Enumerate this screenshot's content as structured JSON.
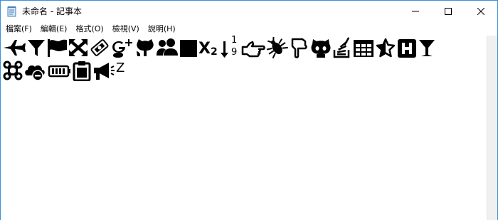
{
  "window": {
    "title": "未命名 - 記事本"
  },
  "menu": {
    "file": "檔案(F)",
    "edit": "編輯(E)",
    "format": "格式(O)",
    "view": "檢視(V)",
    "help": "說明(H)"
  },
  "editor": {
    "row1_icons": [
      "plane-icon",
      "filter-icon",
      "flag-icon",
      "arrows-expand-icon",
      "ticket-icon",
      "google-plus-icon",
      "github-alt-icon",
      "users-icon",
      "square-icon",
      "subscript-icon",
      "sort-numeric-down-icon",
      "hand-point-right-icon",
      "bug-icon",
      "hand-point-down-icon",
      "github-cat-icon",
      "stack-overflow-icon",
      "table-icon",
      "star-half-icon",
      "hospital-h-icon",
      "glass-icon"
    ],
    "row2_icons": [
      "command-icon",
      "cloud-minus-icon",
      "battery-icon",
      "clipboard-icon",
      "megaphone-icon"
    ],
    "subscript_text": "X",
    "subscript_digit": "2",
    "sort_top": "1",
    "sort_bottom": "9",
    "trailing_char": "Z"
  },
  "colors": {
    "border": "#3a8fd8",
    "text": "#000000",
    "scrollbar": "#f0f0f0"
  }
}
